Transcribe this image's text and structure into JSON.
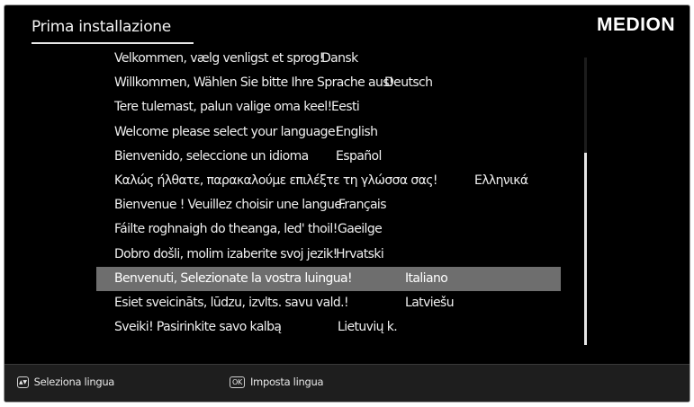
{
  "header": {
    "title": "Prima installazione",
    "brand": "MEDION"
  },
  "languages": [
    {
      "greeting": "Velkommen, vælg venligst et sprog!",
      "name": "Dansk",
      "selected": false
    },
    {
      "greeting": "Willkommen, Wählen Sie bitte Ihre Sprache aus!",
      "name": "Deutsch",
      "selected": false
    },
    {
      "greeting": "Tere tulemast, palun valige oma keel!",
      "name": "Eesti",
      "selected": false
    },
    {
      "greeting": "Welcome please select your language!",
      "name": "English",
      "selected": false
    },
    {
      "greeting": "Bienvenido, seleccione un idioma",
      "name": "Español",
      "selected": false
    },
    {
      "greeting": "Καλώς ήλθατε, παρακαλούμε επιλέξτε τη γλώσσα σας!",
      "name": "Ελληνικά",
      "selected": false
    },
    {
      "greeting": "Bienvenue ! Veuillez choisir une langue.",
      "name": "Français",
      "selected": false
    },
    {
      "greeting": "Fáilte roghnaigh do theanga, led' thoil!",
      "name": "Gaeilge",
      "selected": false
    },
    {
      "greeting": "Dobro došli, molim izaberite svoj jezik!",
      "name": "Hrvatski",
      "selected": false
    },
    {
      "greeting": "Benvenuti, Selezionate la vostra luingua!",
      "name": "Italiano",
      "selected": true
    },
    {
      "greeting": "Esiet sveicināts, lūdzu, izvlts. savu vald.!",
      "name": "Latviešu",
      "selected": false
    },
    {
      "greeting": "Sveiki! Pasirinkite savo kalbą",
      "name": "Lietuvių k.",
      "selected": false
    }
  ],
  "footer": {
    "select_icon": "up-down-arrow-key-icon",
    "select_key_glyph": "▲▼",
    "select_label": "Seleziona lingua",
    "confirm_icon": "ok-key-icon",
    "confirm_key_glyph": "OK",
    "confirm_label": "Imposta lingua"
  },
  "colors": {
    "background": "#000000",
    "selected_row": "#6e6e6e",
    "footer": "#1e1e1e",
    "text": "#f0f0f0"
  }
}
